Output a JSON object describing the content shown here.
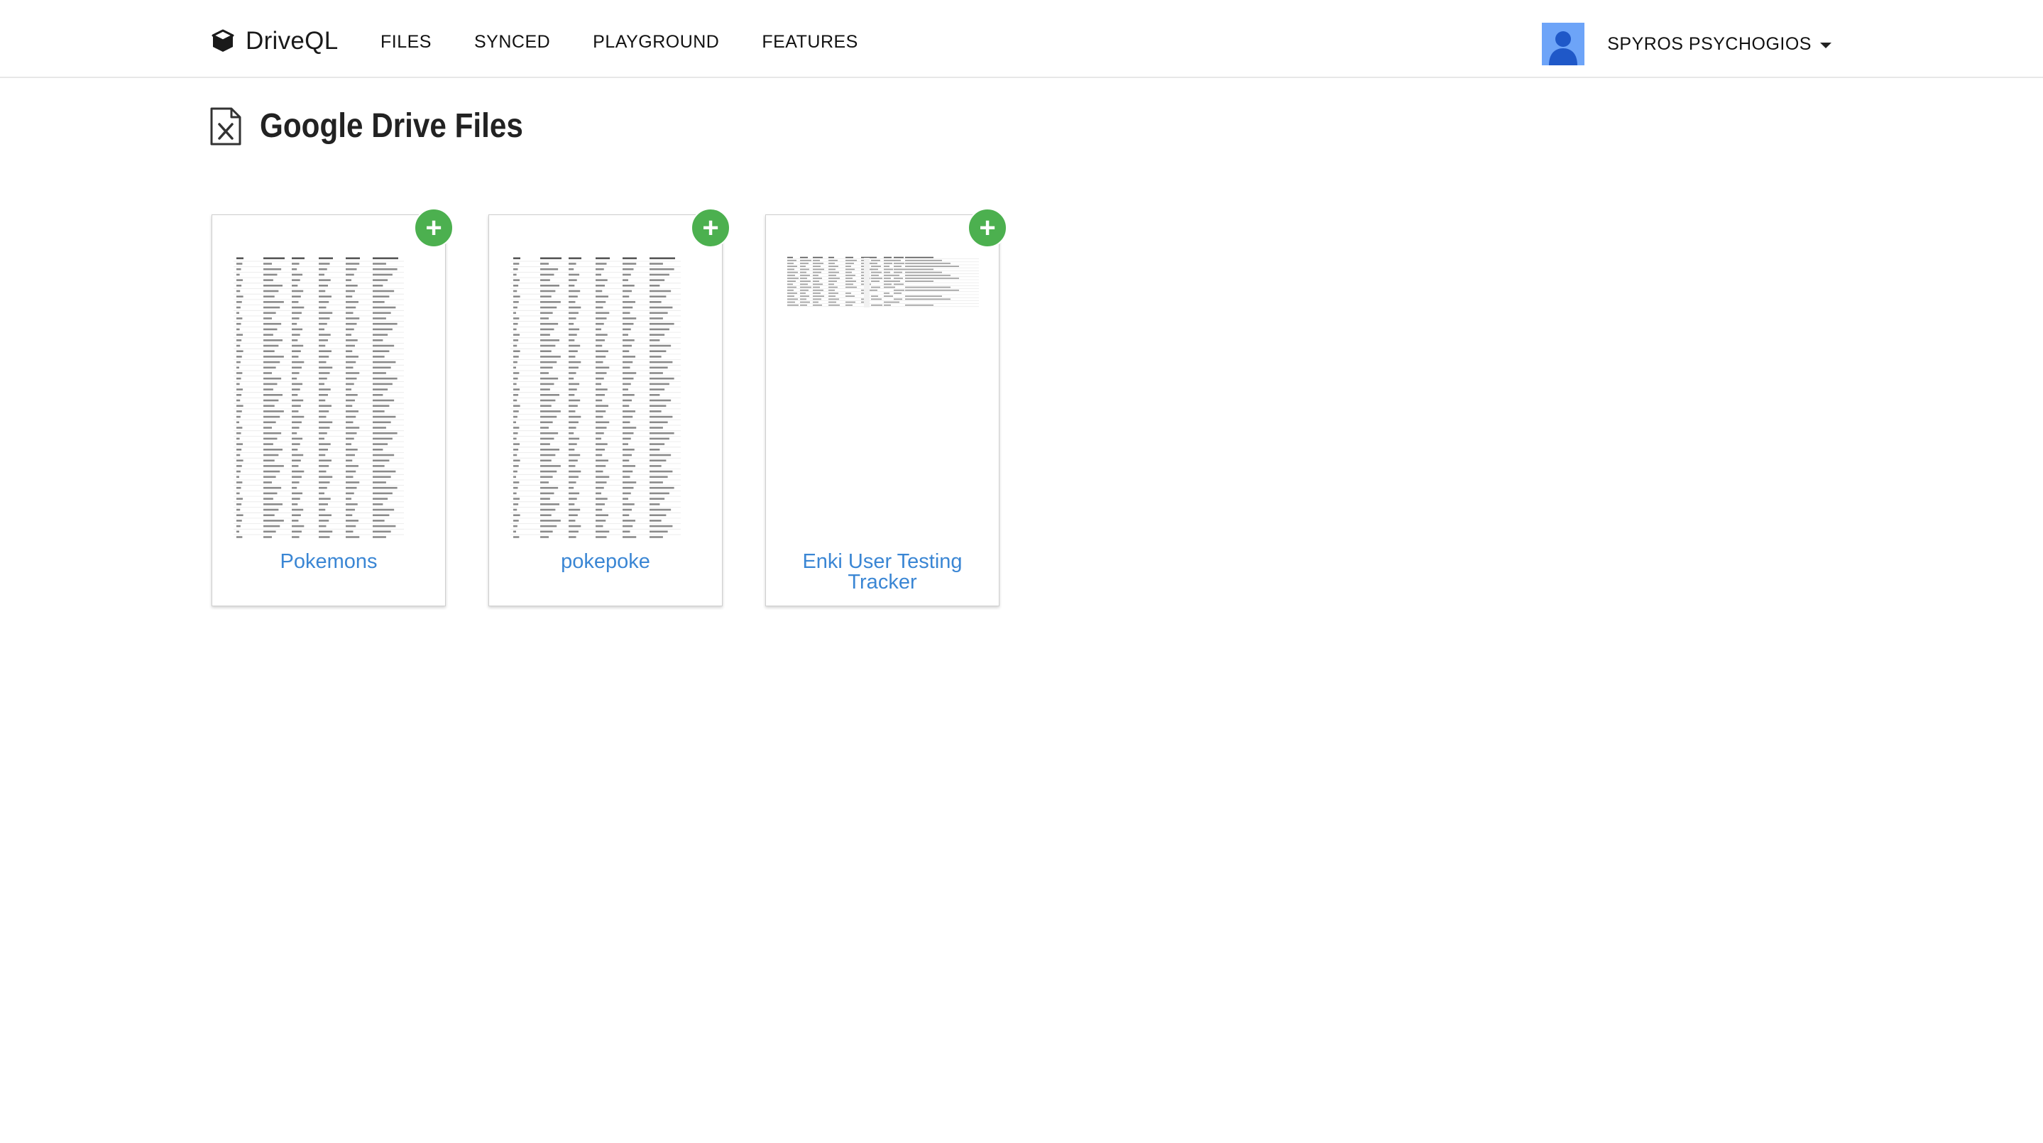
{
  "brand": {
    "name": "DriveQL",
    "icon": "cube-icon"
  },
  "nav": {
    "links": [
      {
        "label": "FILES"
      },
      {
        "label": "SYNCED"
      },
      {
        "label": "PLAYGROUND"
      },
      {
        "label": "FEATURES"
      }
    ]
  },
  "user": {
    "name": "SPYROS PSYCHOGIOS",
    "avatar_icon": "user-avatar-icon",
    "avatar_color": "#4f8ef7"
  },
  "page": {
    "title": "Google Drive Files",
    "icon": "spreadsheet-file-icon"
  },
  "files": [
    {
      "name": "Pokemons",
      "add_label": "+",
      "thumbnail": "spreadsheet-thumbnail"
    },
    {
      "name": "pokepoke",
      "add_label": "+",
      "thumbnail": "spreadsheet-thumbnail"
    },
    {
      "name": "Enki User Testing Tracker",
      "add_label": "+",
      "thumbnail": "spreadsheet-thumbnail"
    }
  ],
  "colors": {
    "accent_link": "#3a86d4",
    "add_button": "#4cb04f"
  }
}
